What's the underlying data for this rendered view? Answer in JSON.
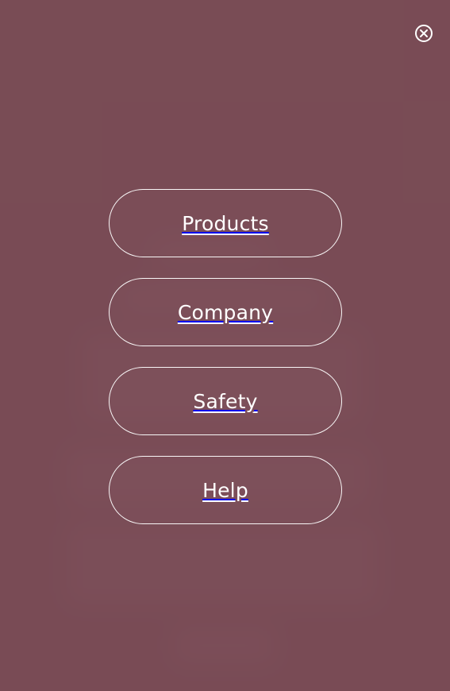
{
  "close_icon": "close-circle-icon",
  "menu": {
    "items": [
      {
        "label": "Products"
      },
      {
        "label": "Company"
      },
      {
        "label": "Safety"
      },
      {
        "label": "Help"
      }
    ]
  },
  "colors": {
    "background": "#7a5058",
    "overlay": "#784a54",
    "text": "#ffffff",
    "border": "#ffffff"
  }
}
